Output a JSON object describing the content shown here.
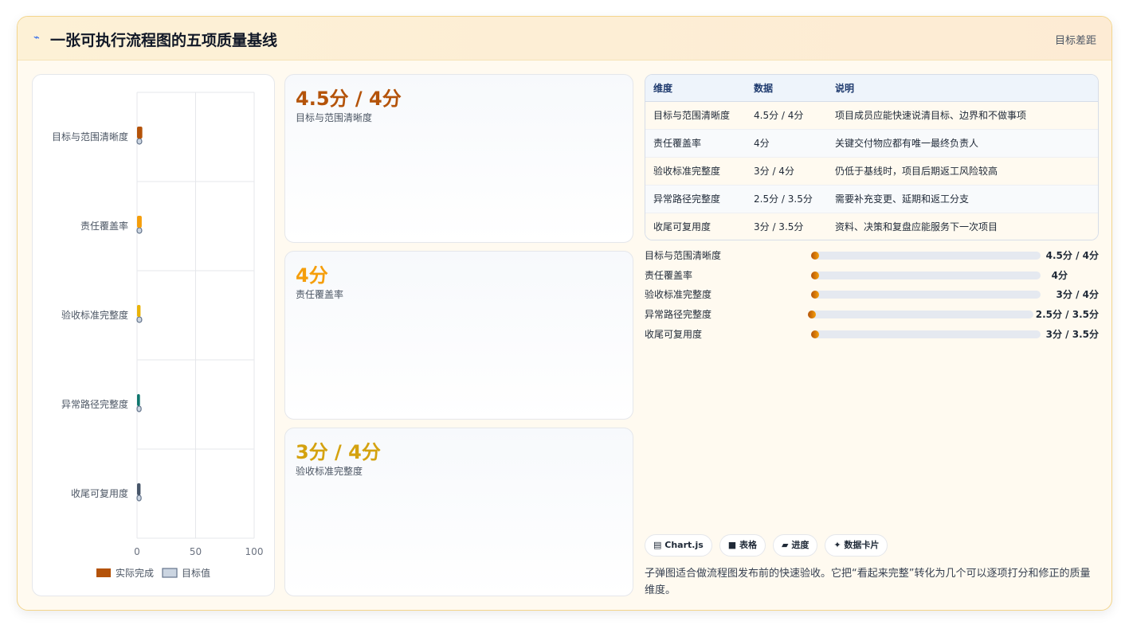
{
  "header": {
    "icon": "bolt-icon",
    "title": "一张可执行流程图的五项质量基线",
    "right_label": "目标差距"
  },
  "chart_data": {
    "type": "bar",
    "orientation": "horizontal",
    "categories": [
      "目标与范围清晰度",
      "责任覆盖率",
      "验收标准完整度",
      "异常路径完整度",
      "收尾可复用度"
    ],
    "series": [
      {
        "name": "实际完成",
        "values": [
          4.5,
          4,
          3,
          2.5,
          3
        ],
        "colors": [
          "#b45309",
          "#f59e0b",
          "#eab308",
          "#0f766e",
          "#475569"
        ]
      },
      {
        "name": "目标值",
        "values": [
          4,
          4,
          4,
          3.5,
          3.5
        ],
        "color": "#cbd5e1"
      }
    ],
    "xlim": [
      0,
      100
    ],
    "xticks": [
      "0",
      "50",
      "100"
    ],
    "grid": true,
    "legend": "bottom"
  },
  "cards": [
    {
      "value": "4.5分 / 4分",
      "label": "目标与范围清晰度",
      "color": "#b45309"
    },
    {
      "value": "4分",
      "label": "责任覆盖率",
      "color": "#f59e0b"
    },
    {
      "value": "3分 / 4分",
      "label": "验收标准完整度",
      "color": "#d4a20f"
    }
  ],
  "table": {
    "headers": [
      "维度",
      "数据",
      "说明"
    ],
    "rows": [
      [
        "目标与范围清晰度",
        "4.5分 / 4分",
        "项目成员应能快速说清目标、边界和不做事项"
      ],
      [
        "责任覆盖率",
        "4分",
        "关键交付物应都有唯一最终负责人"
      ],
      [
        "验收标准完整度",
        "3分 / 4分",
        "仍低于基线时，项目后期返工风险较高"
      ],
      [
        "异常路径完整度",
        "2.5分 / 3.5分",
        "需要补充变更、延期和返工分支"
      ],
      [
        "收尾可复用度",
        "3分 / 3.5分",
        "资料、决策和复盘应能服务下一次项目"
      ]
    ]
  },
  "progress": [
    {
      "label": "目标与范围清晰度",
      "value": "4.5分 / 4分",
      "fraction": 0.02
    },
    {
      "label": "责任覆盖率",
      "value": "4分",
      "fraction": 0.02
    },
    {
      "label": "验收标准完整度",
      "value": "3分 / 4分",
      "fraction": 0.02
    },
    {
      "label": "异常路径完整度",
      "value": "2.5分 / 3.5分",
      "fraction": 0.02
    },
    {
      "label": "收尾可复用度",
      "value": "3分 / 3.5分",
      "fraction": 0.02
    }
  ],
  "chips": [
    {
      "icon": "chart-icon",
      "glyph": "▤",
      "label": "Chart.js"
    },
    {
      "icon": "table-icon",
      "glyph": "■",
      "label": "表格"
    },
    {
      "icon": "progress-icon",
      "glyph": "▰",
      "label": "进度"
    },
    {
      "icon": "sparkle-icon",
      "glyph": "✦",
      "label": "数据卡片"
    }
  ],
  "description": "子弹图适合做流程图发布前的快速验收。它把“看起来完整”转化为几个可以逐项打分和修正的质量维度。"
}
